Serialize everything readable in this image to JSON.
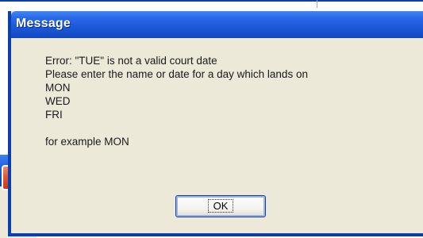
{
  "background_window": {
    "close_glyph": "✕"
  },
  "dialog": {
    "title": "Message",
    "message_lines": [
      "Error: \"TUE\" is not a valid court date",
      "Please enter the name or date for a day which lands on",
      "MON",
      "WED",
      "FRI",
      "",
      "for example MON"
    ],
    "ok_label": "OK"
  },
  "colors": {
    "titlebar": "#2a6ae8",
    "dialog_body": "#ECE9D8",
    "close_button": "#e05a38",
    "title_text": "#ffffff"
  }
}
